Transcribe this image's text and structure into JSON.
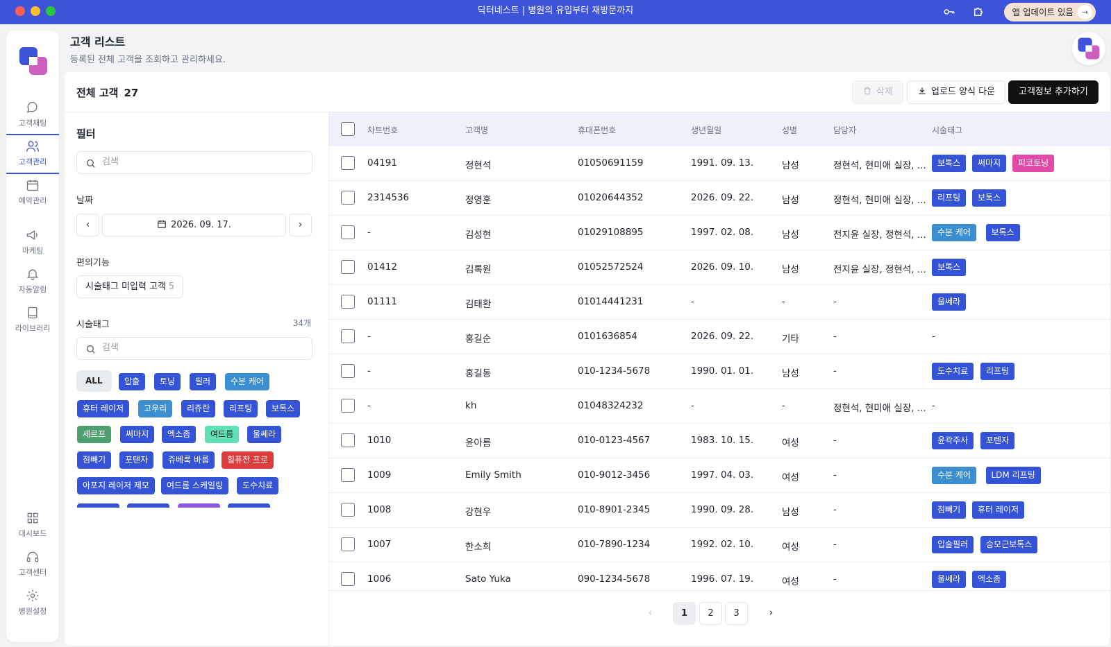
{
  "window": {
    "title": "닥터네스트 | 병원의 유입부터 재방문까지",
    "update_label": "앱 업데이트 있음",
    "update_arrow": "→",
    "key_icon": "key-icon",
    "extension_icon": "puzzle-icon"
  },
  "sidebar": {
    "items": [
      {
        "label": "고객채팅",
        "icon": "chat-icon"
      },
      {
        "label": "고객관리",
        "icon": "users-icon",
        "active": true
      },
      {
        "label": "예약관리",
        "icon": "calendar-icon"
      },
      {
        "label": "마케팅",
        "icon": "megaphone-icon"
      },
      {
        "label": "자동알림",
        "icon": "bell-icon"
      },
      {
        "label": "라이브러리",
        "icon": "book-icon"
      },
      {
        "label": "대시보드",
        "icon": "dashboard-icon"
      },
      {
        "label": "고객센터",
        "icon": "headset-icon"
      },
      {
        "label": "병원설정",
        "icon": "gear-icon"
      }
    ]
  },
  "page": {
    "title": "고객 리스트",
    "subtitle": "등록된 전체 고객을 조회하고 관리하세요."
  },
  "toolbar": {
    "total_label": "전체 고객",
    "total_count": "27",
    "delete_label": "삭제",
    "download_label": "업로드 양식 다운",
    "add_label": "고객정보 추가하기"
  },
  "filter": {
    "title": "필터",
    "search_placeholder": "검색",
    "date_label": "날짜",
    "date_value": "2026. 09. 17.",
    "date_prev": "‹",
    "date_next": "›",
    "convenience_label": "편의기능",
    "convenience_chip": "시술태그 미입력 고객",
    "convenience_count": "5",
    "tag_label": "시술태그",
    "tag_count": "34개",
    "tag_search_placeholder": "검색",
    "tags": [
      {
        "label": "ALL",
        "color": "all"
      },
      {
        "label": "압출",
        "color": "blue"
      },
      {
        "label": "토닝",
        "color": "blue"
      },
      {
        "label": "필러",
        "color": "blue"
      },
      {
        "label": "수분 케어",
        "color": "sky"
      },
      {
        "label": "휴터 레이저",
        "color": "blue"
      },
      {
        "label": "고우리",
        "color": "sky"
      },
      {
        "label": "리쥬란",
        "color": "blue"
      },
      {
        "label": "리프팅",
        "color": "blue"
      },
      {
        "label": "보톡스",
        "color": "blue"
      },
      {
        "label": "세르프",
        "color": "green"
      },
      {
        "label": "써마지",
        "color": "blue"
      },
      {
        "label": "엑소좀",
        "color": "blue"
      },
      {
        "label": "여드름",
        "color": "mint"
      },
      {
        "label": "울쎄라",
        "color": "blue"
      },
      {
        "label": "점빼기",
        "color": "blue"
      },
      {
        "label": "포텐자",
        "color": "blue"
      },
      {
        "label": "쥬베룩 바름",
        "color": "blue"
      },
      {
        "label": "힐퓨전 프로",
        "color": "red"
      },
      {
        "label": "아포지 레이저 제모",
        "color": "blue"
      },
      {
        "label": "여드름 스케일링",
        "color": "blue"
      },
      {
        "label": "도수치료",
        "color": "blue"
      }
    ]
  },
  "table": {
    "headers": [
      "차트번호",
      "고객명",
      "휴대폰번호",
      "생년월일",
      "성별",
      "담당자",
      "시술태그"
    ],
    "rows": [
      {
        "chart": "04191",
        "name": "정현석",
        "phone": "01050691159",
        "birth": "1991. 09. 13.",
        "gender": "남성",
        "staff": "정현석, 현미애 실장, ...",
        "tags": [
          {
            "label": "보톡스",
            "color": "blue"
          },
          {
            "label": "써마지",
            "color": "blue"
          },
          {
            "label": "피코토닝",
            "color": "pink"
          }
        ]
      },
      {
        "chart": "2314536",
        "name": "정영훈",
        "phone": "01020644352",
        "birth": "2026. 09. 22.",
        "gender": "남성",
        "staff": "정현석, 현미애 실장, ...",
        "tags": [
          {
            "label": "리프팅",
            "color": "blue"
          },
          {
            "label": "보톡스",
            "color": "blue"
          }
        ]
      },
      {
        "chart": "-",
        "name": "김성현",
        "phone": "01029108895",
        "birth": "1997. 02. 08.",
        "gender": "남성",
        "staff": "전지윤 실장, 정현석, ...",
        "tags": [
          {
            "label": "수분 케어",
            "color": "sky"
          },
          {
            "label": "보톡스",
            "color": "blue"
          }
        ]
      },
      {
        "chart": "01412",
        "name": "김록원",
        "phone": "01052572524",
        "birth": "2026. 09. 10.",
        "gender": "남성",
        "staff": "전지윤 실장, 정현석, ...",
        "tags": [
          {
            "label": "보톡스",
            "color": "blue"
          }
        ]
      },
      {
        "chart": "01111",
        "name": "김태환",
        "phone": "01014441231",
        "birth": "-",
        "gender": "-",
        "staff": "-",
        "tags": [
          {
            "label": "울쎄라",
            "color": "blue"
          }
        ]
      },
      {
        "chart": "-",
        "name": "홍길순",
        "phone": "0101636854",
        "birth": "2026. 09. 22.",
        "gender": "기타",
        "staff": "-",
        "tags": [],
        "tags_empty": "-"
      },
      {
        "chart": "-",
        "name": "홍길동",
        "phone": "010-1234-5678",
        "birth": "1990. 01. 01.",
        "gender": "남성",
        "staff": "-",
        "tags": [
          {
            "label": "도수치료",
            "color": "blue"
          },
          {
            "label": "리프팅",
            "color": "blue"
          }
        ]
      },
      {
        "chart": "-",
        "name": "kh",
        "phone": "01048324232",
        "birth": "-",
        "gender": "-",
        "staff": "정현석, 현미애 실장, ...",
        "tags": [],
        "tags_empty": "-"
      },
      {
        "chart": "1010",
        "name": "윤아름",
        "phone": "010-0123-4567",
        "birth": "1983. 10. 15.",
        "gender": "여성",
        "staff": "-",
        "tags": [
          {
            "label": "윤곽주사",
            "color": "blue"
          },
          {
            "label": "포텐자",
            "color": "blue"
          }
        ]
      },
      {
        "chart": "1009",
        "name": "Emily Smith",
        "phone": "010-9012-3456",
        "birth": "1997. 04. 03.",
        "gender": "여성",
        "staff": "-",
        "tags": [
          {
            "label": "수분 케어",
            "color": "sky"
          },
          {
            "label": "LDM 리프팅",
            "color": "blue"
          }
        ]
      },
      {
        "chart": "1008",
        "name": "강현우",
        "phone": "010-8901-2345",
        "birth": "1990. 09. 28.",
        "gender": "남성",
        "staff": "-",
        "tags": [
          {
            "label": "점빼기",
            "color": "blue"
          },
          {
            "label": "휴터 레이저",
            "color": "blue"
          }
        ]
      },
      {
        "chart": "1007",
        "name": "한소희",
        "phone": "010-7890-1234",
        "birth": "1992. 02. 10.",
        "gender": "여성",
        "staff": "-",
        "tags": [
          {
            "label": "입술필러",
            "color": "blue"
          },
          {
            "label": "승모근보톡스",
            "color": "blue"
          }
        ]
      },
      {
        "chart": "1006",
        "name": "Sato Yuka",
        "phone": "090-1234-5678",
        "birth": "1996. 07. 19.",
        "gender": "여성",
        "staff": "-",
        "tags": [
          {
            "label": "울쎄라",
            "color": "blue"
          },
          {
            "label": "엑소좀",
            "color": "blue"
          }
        ]
      }
    ]
  },
  "pagination": {
    "prev": "‹",
    "next": "›",
    "pages": [
      "1",
      "2",
      "3"
    ],
    "current": "1"
  }
}
